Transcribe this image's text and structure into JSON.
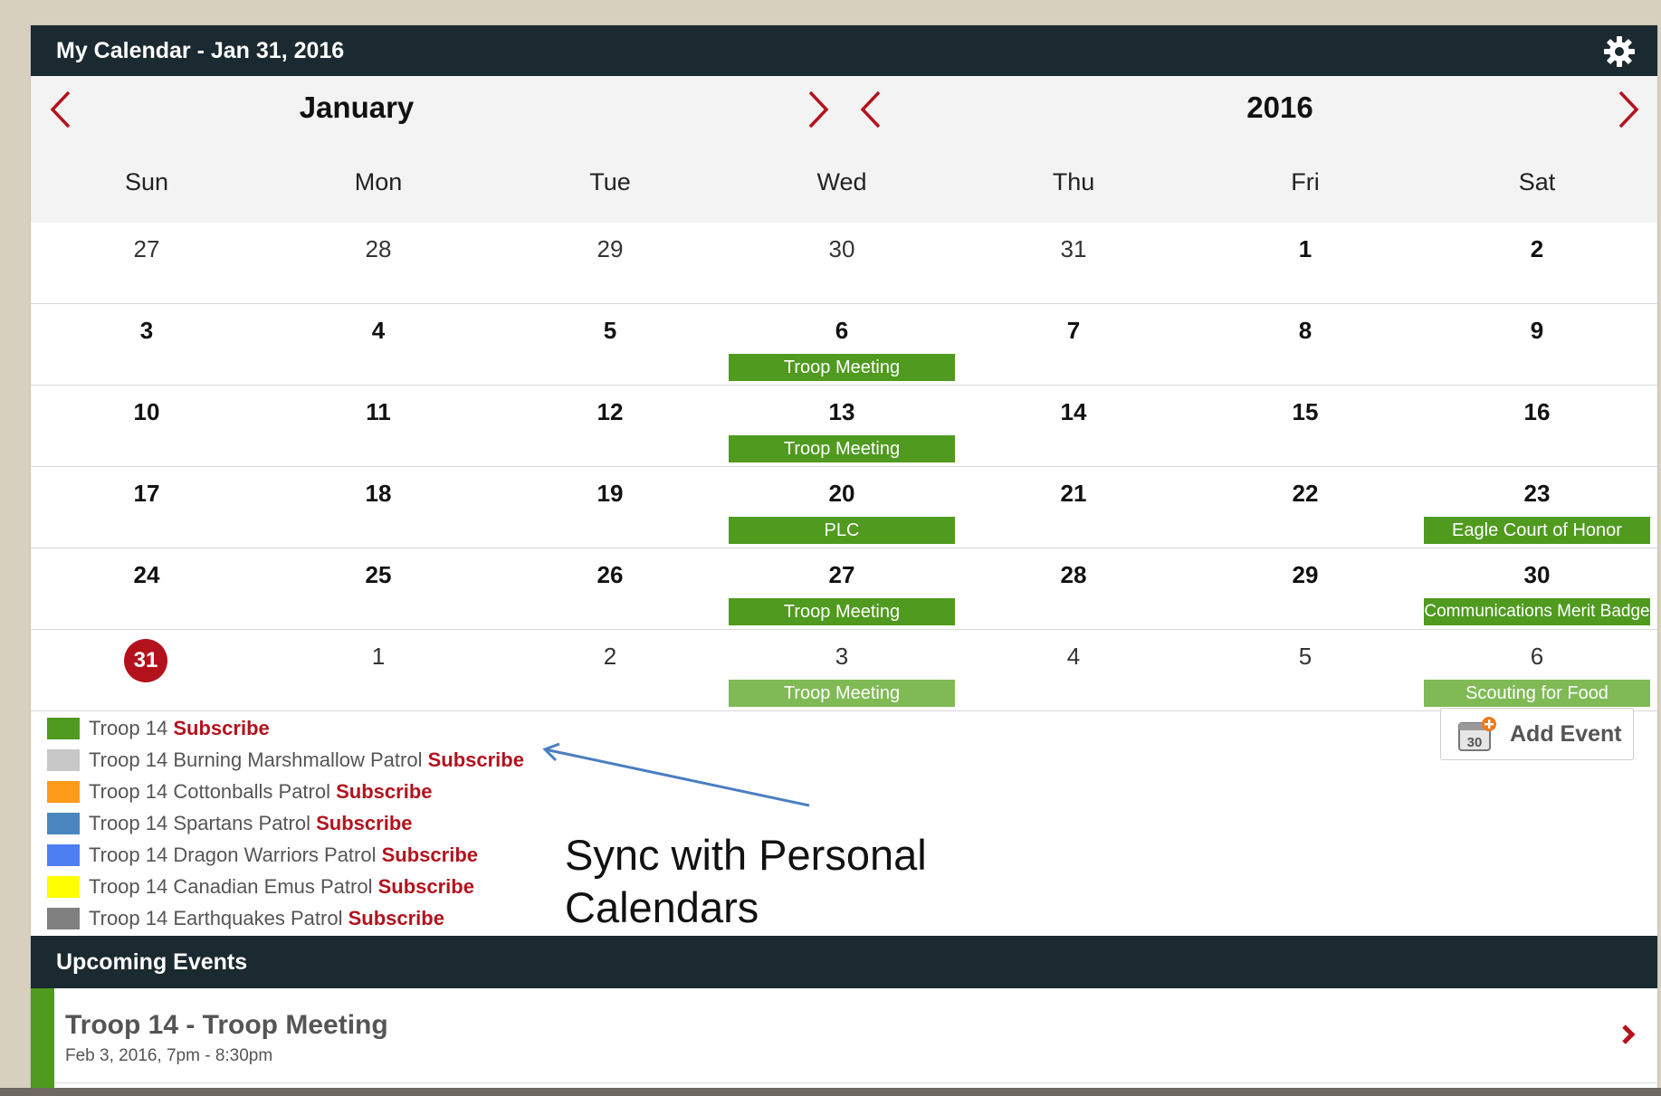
{
  "header": {
    "title": "My Calendar - Jan 31, 2016"
  },
  "nav": {
    "month": "January",
    "year": "2016"
  },
  "weekdays": [
    "Sun",
    "Mon",
    "Tue",
    "Wed",
    "Thu",
    "Fri",
    "Sat"
  ],
  "weeks": [
    {
      "days": [
        "27",
        "28",
        "29",
        "30",
        "31",
        "1",
        "2"
      ]
    },
    {
      "days": [
        "3",
        "4",
        "5",
        "6",
        "7",
        "8",
        "9"
      ]
    },
    {
      "days": [
        "10",
        "11",
        "12",
        "13",
        "14",
        "15",
        "16"
      ]
    },
    {
      "days": [
        "17",
        "18",
        "19",
        "20",
        "21",
        "22",
        "23"
      ]
    },
    {
      "days": [
        "24",
        "25",
        "26",
        "27",
        "28",
        "29",
        "30"
      ]
    },
    {
      "days": [
        "31",
        "1",
        "2",
        "3",
        "4",
        "5",
        "6"
      ]
    }
  ],
  "events": [
    {
      "label": "Troop Meeting"
    },
    {
      "label": "Troop Meeting"
    },
    {
      "label": "PLC"
    },
    {
      "label": "Eagle Court of Honor"
    },
    {
      "label": "Troop Meeting"
    },
    {
      "label": "Communications Merit Badge"
    },
    {
      "label": "Troop Meeting"
    },
    {
      "label": "Scouting for Food"
    }
  ],
  "legend": [
    {
      "name": "Troop 14",
      "color": "#4f9a1f",
      "action": "Subscribe"
    },
    {
      "name": "Troop 14 Burning Marshmallow Patrol",
      "color": "#c8c8c8",
      "action": "Subscribe"
    },
    {
      "name": "Troop 14 Cottonballs Patrol",
      "color": "#ff9a1a",
      "action": "Subscribe"
    },
    {
      "name": "Troop 14 Spartans Patrol",
      "color": "#4a86c0",
      "action": "Subscribe"
    },
    {
      "name": "Troop 14 Dragon Warriors Patrol",
      "color": "#4d7ff2",
      "action": "Subscribe"
    },
    {
      "name": "Troop 14 Canadian Emus Patrol",
      "color": "#ffff00",
      "action": "Subscribe"
    },
    {
      "name": "Troop 14 Earthquakes Patrol",
      "color": "#808080",
      "action": "Subscribe"
    }
  ],
  "add_event": {
    "label": "Add Event",
    "icon_number": "30"
  },
  "annotation": {
    "line1": "Sync with Personal",
    "line2": "Calendars"
  },
  "upcoming": {
    "heading": "Upcoming Events",
    "items": [
      {
        "title": "Troop 14 - Troop Meeting",
        "date": "Feb 3, 2016, 7pm - 8:30pm"
      }
    ]
  },
  "colors": {
    "header_bg": "#1b2a30",
    "accent_red": "#b3121d",
    "event_green": "#4f9a1f",
    "event_green_light": "#7fba55"
  }
}
